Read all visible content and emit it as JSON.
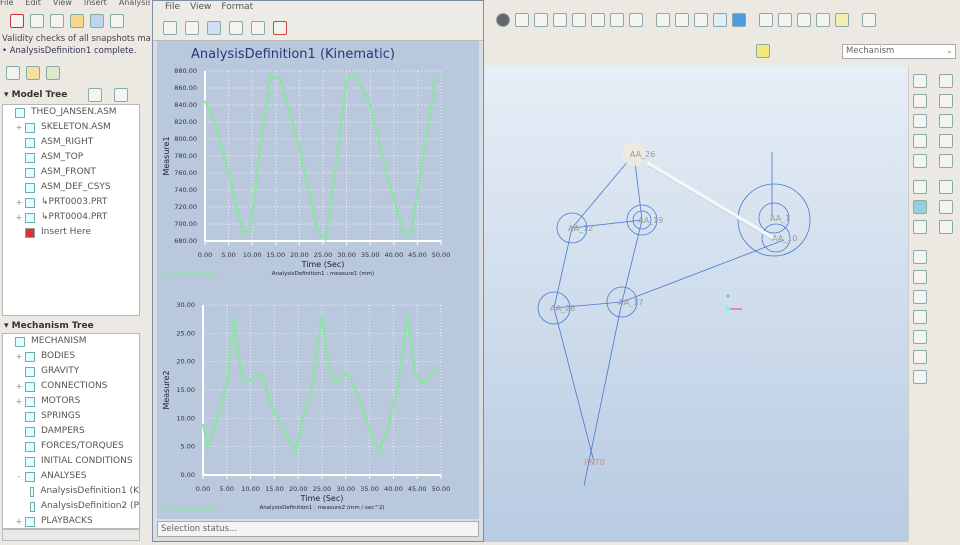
{
  "main_menu": [
    "File",
    "Edit",
    "View",
    "Insert",
    "Analysis"
  ],
  "messages": [
    "Validity checks of all snapshots may b",
    "• AnalysisDefinition1 complete."
  ],
  "model_tree": {
    "title": "Model Tree",
    "items": [
      {
        "label": "THEO_JANSEN.ASM",
        "indent": 0,
        "expand": "",
        "icon": "assembly-icon"
      },
      {
        "label": "SKELETON.ASM",
        "indent": 1,
        "expand": "+",
        "icon": "skeleton-icon"
      },
      {
        "label": "ASM_RIGHT",
        "indent": 1,
        "expand": "",
        "icon": "datum-plane-icon"
      },
      {
        "label": "ASM_TOP",
        "indent": 1,
        "expand": "",
        "icon": "datum-plane-icon"
      },
      {
        "label": "ASM_FRONT",
        "indent": 1,
        "expand": "",
        "icon": "datum-plane-icon"
      },
      {
        "label": "ASM_DEF_CSYS",
        "indent": 1,
        "expand": "",
        "icon": "csys-icon"
      },
      {
        "label": "↳PRT0003.PRT",
        "indent": 1,
        "expand": "+",
        "icon": "part-icon"
      },
      {
        "label": "↳PRT0004.PRT",
        "indent": 1,
        "expand": "+",
        "icon": "part-icon"
      },
      {
        "label": "Insert Here",
        "indent": 1,
        "expand": "",
        "icon": "insert-arrow-icon"
      }
    ]
  },
  "mechanism_tree": {
    "title": "Mechanism Tree",
    "items": [
      {
        "label": "MECHANISM",
        "indent": 0,
        "expand": ""
      },
      {
        "label": "BODIES",
        "indent": 1,
        "expand": "+"
      },
      {
        "label": "GRAVITY",
        "indent": 1,
        "expand": ""
      },
      {
        "label": "CONNECTIONS",
        "indent": 1,
        "expand": "+"
      },
      {
        "label": "MOTORS",
        "indent": 1,
        "expand": "+"
      },
      {
        "label": "SPRINGS",
        "indent": 1,
        "expand": ""
      },
      {
        "label": "DAMPERS",
        "indent": 1,
        "expand": ""
      },
      {
        "label": "FORCES/TORQUES",
        "indent": 1,
        "expand": ""
      },
      {
        "label": "INITIAL CONDITIONS",
        "indent": 1,
        "expand": ""
      },
      {
        "label": "ANALYSES",
        "indent": 1,
        "expand": "-"
      },
      {
        "label": "AnalysisDefinition1 (K",
        "indent": 2,
        "expand": ""
      },
      {
        "label": "AnalysisDefinition2 (P",
        "indent": 2,
        "expand": ""
      },
      {
        "label": "PLAYBACKS",
        "indent": 1,
        "expand": "+"
      }
    ]
  },
  "graph_window": {
    "menu": [
      "File",
      "View",
      "Format"
    ],
    "status": "Selection status..."
  },
  "mode_select": "Mechanism",
  "colors": {
    "series": "#8fe3a8",
    "plot_bg": "#b9c8dc",
    "viewport_line": "#4a78d0"
  },
  "joints": [
    "AA_26",
    "AA_12",
    "AA_19",
    "AA_1",
    "AA_10",
    "AA_28",
    "AA_17",
    "PNT0"
  ],
  "chart_data": [
    {
      "type": "line",
      "title": "AnalysisDefinition1 (Kinematic)",
      "xlabel": "Time (Sec)",
      "ylabel": "Measure1",
      "legend": "AnalysisDefinition1 : measure1  (mm)",
      "xlim": [
        0,
        50
      ],
      "ylim": [
        680,
        880
      ],
      "grid": true,
      "xticks": [
        "0.00",
        "5.00",
        "10.00",
        "15.00",
        "20.00",
        "25.00",
        "30.00",
        "35.00",
        "40.00",
        "45.00",
        "50.00"
      ],
      "yticks": [
        "680.00",
        "700.00",
        "720.00",
        "740.00",
        "760.00",
        "780.00",
        "800.00",
        "820.00",
        "840.00",
        "860.00",
        "880.00"
      ],
      "x": [
        0,
        2,
        5,
        8,
        9.5,
        12,
        14,
        16,
        20,
        24,
        25.5,
        28,
        30,
        32,
        35,
        38,
        42,
        43.5,
        46,
        49
      ],
      "y": [
        845,
        820,
        760,
        690,
        690,
        800,
        875,
        870,
        790,
        690,
        682,
        780,
        870,
        875,
        840,
        770,
        690,
        685,
        770,
        875
      ]
    },
    {
      "type": "line",
      "title": "",
      "xlabel": "Time (Sec)",
      "ylabel": "Measure2",
      "legend": "AnalysisDefinition1 : measure2  (mm / sec^2)",
      "xlim": [
        0,
        50
      ],
      "ylim": [
        0,
        30
      ],
      "grid": true,
      "xticks": [
        "0.00",
        "5.00",
        "10.00",
        "15.00",
        "20.00",
        "25.00",
        "30.00",
        "35.00",
        "40.00",
        "45.00",
        "50.00"
      ],
      "yticks": [
        "0.00",
        "5.00",
        "10.00",
        "15.00",
        "20.00",
        "25.00",
        "30.00"
      ],
      "x": [
        0,
        1,
        3,
        5,
        6.5,
        8,
        9,
        10.5,
        12,
        13,
        15,
        17,
        19.5,
        21,
        23,
        25,
        26.5,
        27.5,
        30,
        31,
        33,
        35,
        37,
        39,
        41,
        43,
        44.5,
        46,
        49
      ],
      "y": [
        9,
        5,
        10,
        16,
        28,
        18,
        16,
        17,
        18,
        16,
        11,
        8,
        4,
        10,
        16,
        28,
        19,
        16,
        18,
        17,
        13,
        8,
        4,
        9,
        16,
        28,
        18,
        16,
        19
      ]
    }
  ]
}
